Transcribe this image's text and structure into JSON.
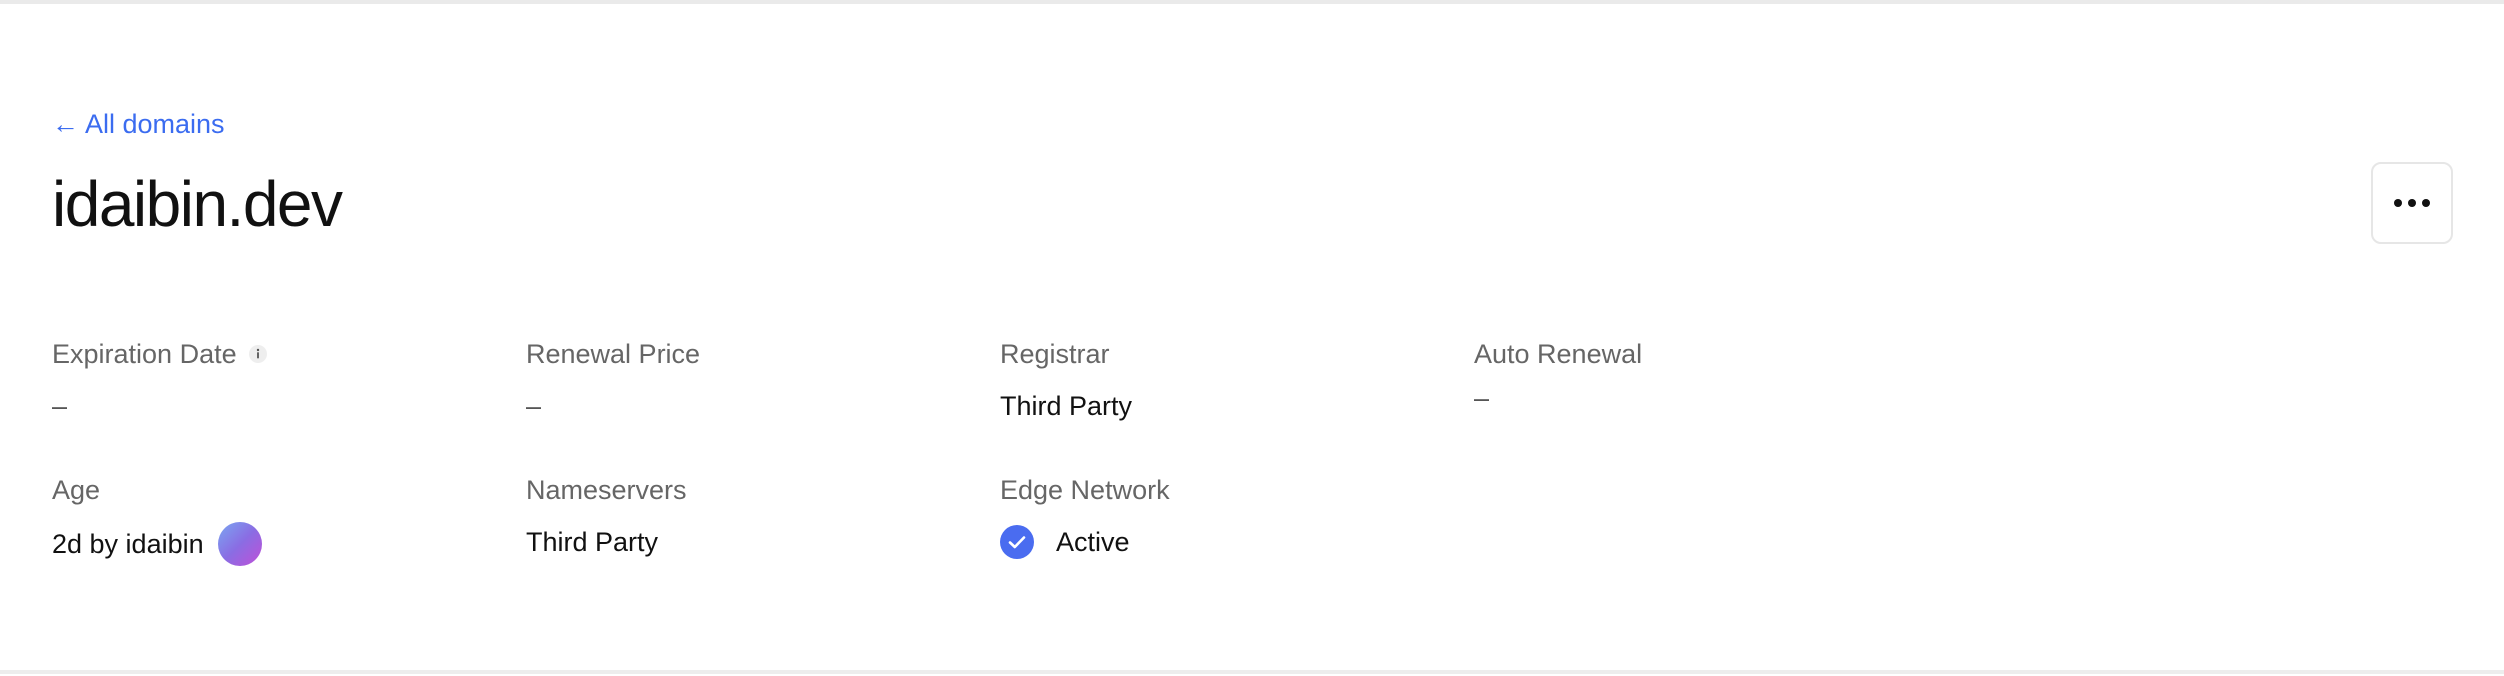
{
  "header": {
    "back_link": {
      "arrow": "←",
      "label": "All domains"
    },
    "title": "idaibin.dev",
    "more_button_icon": "ellipsis-icon"
  },
  "details": {
    "expiration_date": {
      "label": "Expiration Date",
      "value": "–",
      "info_icon": "info-icon"
    },
    "renewal_price": {
      "label": "Renewal Price",
      "value": "–"
    },
    "registrar": {
      "label": "Registrar",
      "value": "Third Party"
    },
    "auto_renewal": {
      "label": "Auto Renewal",
      "value": "–"
    },
    "age": {
      "label": "Age",
      "value": "2d by idaibin"
    },
    "nameservers": {
      "label": "Nameservers",
      "value": "Third Party"
    },
    "edge_network": {
      "label": "Edge Network",
      "value": "Active",
      "status_icon": "check-circle-icon"
    }
  },
  "colors": {
    "link": "#3b6cf0",
    "check_badge": "#4a6cf0",
    "label": "#666666",
    "text": "#111111"
  }
}
